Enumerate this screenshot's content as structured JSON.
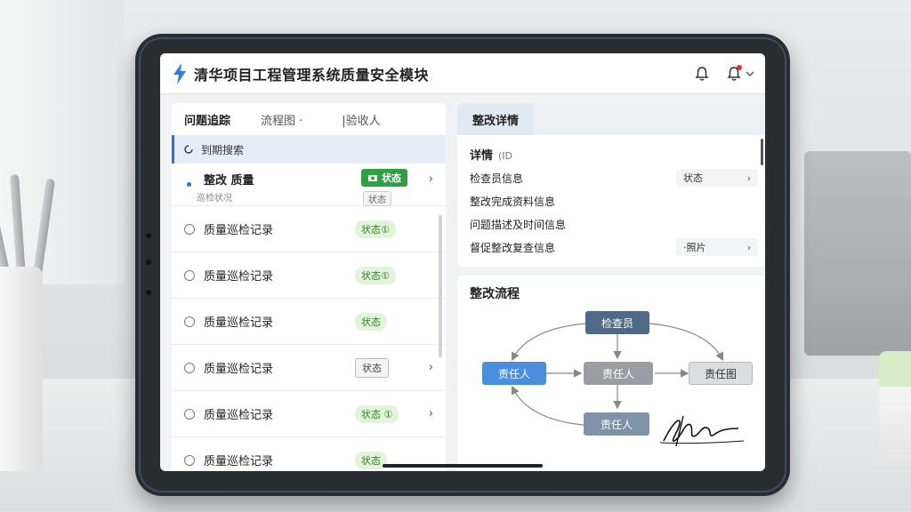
{
  "header": {
    "title": "清华项目工程管理系统质量安全模块",
    "icons": [
      "logo-bolt-icon",
      "bell-icon",
      "notification-bell-icon",
      "chevron-down-icon"
    ]
  },
  "left": {
    "tabs": [
      "问题追踪",
      "流程图 ·",
      "|验收人"
    ],
    "search_label": "到期搜索",
    "items": [
      {
        "label": "整改 质量",
        "sub": "巡检状况",
        "tag": "状态",
        "tag_style": "solid",
        "sub_tag": "状态"
      },
      {
        "label": "质量巡检记录",
        "tag": "状态①",
        "tag_style": "green"
      },
      {
        "label": "质量巡检记录",
        "tag": "状态①",
        "tag_style": "green"
      },
      {
        "label": "质量巡检记录",
        "tag": "状态",
        "tag_style": "green"
      },
      {
        "label": "质量巡检记录",
        "tag": "状态",
        "tag_style": "gray"
      },
      {
        "label": "质量巡检记录",
        "tag": "状态 ①",
        "tag_style": "green"
      },
      {
        "label": "质量巡检记录",
        "tag": "状态",
        "tag_style": "green"
      }
    ]
  },
  "detail": {
    "tab": "整改详情",
    "title": "详情",
    "title_sub": "(ID",
    "rows": [
      {
        "label": "检查员信息",
        "select": "状态"
      },
      {
        "label": "整改完成资料信息"
      },
      {
        "label": "问题描述及时间信息"
      },
      {
        "label": "督促整改复查信息",
        "select": "·照片"
      }
    ]
  },
  "flow": {
    "title": "整改流程",
    "nodes": {
      "top": "检查员",
      "left": "责任人",
      "center": "责任人",
      "right": "责任图",
      "bottom": "责任人"
    },
    "colors": {
      "top": "#4f6a86",
      "left": "#4a8ee0",
      "center": "#9a9da1",
      "right": "#dcdde0",
      "bottom": "#7e93a8"
    }
  }
}
